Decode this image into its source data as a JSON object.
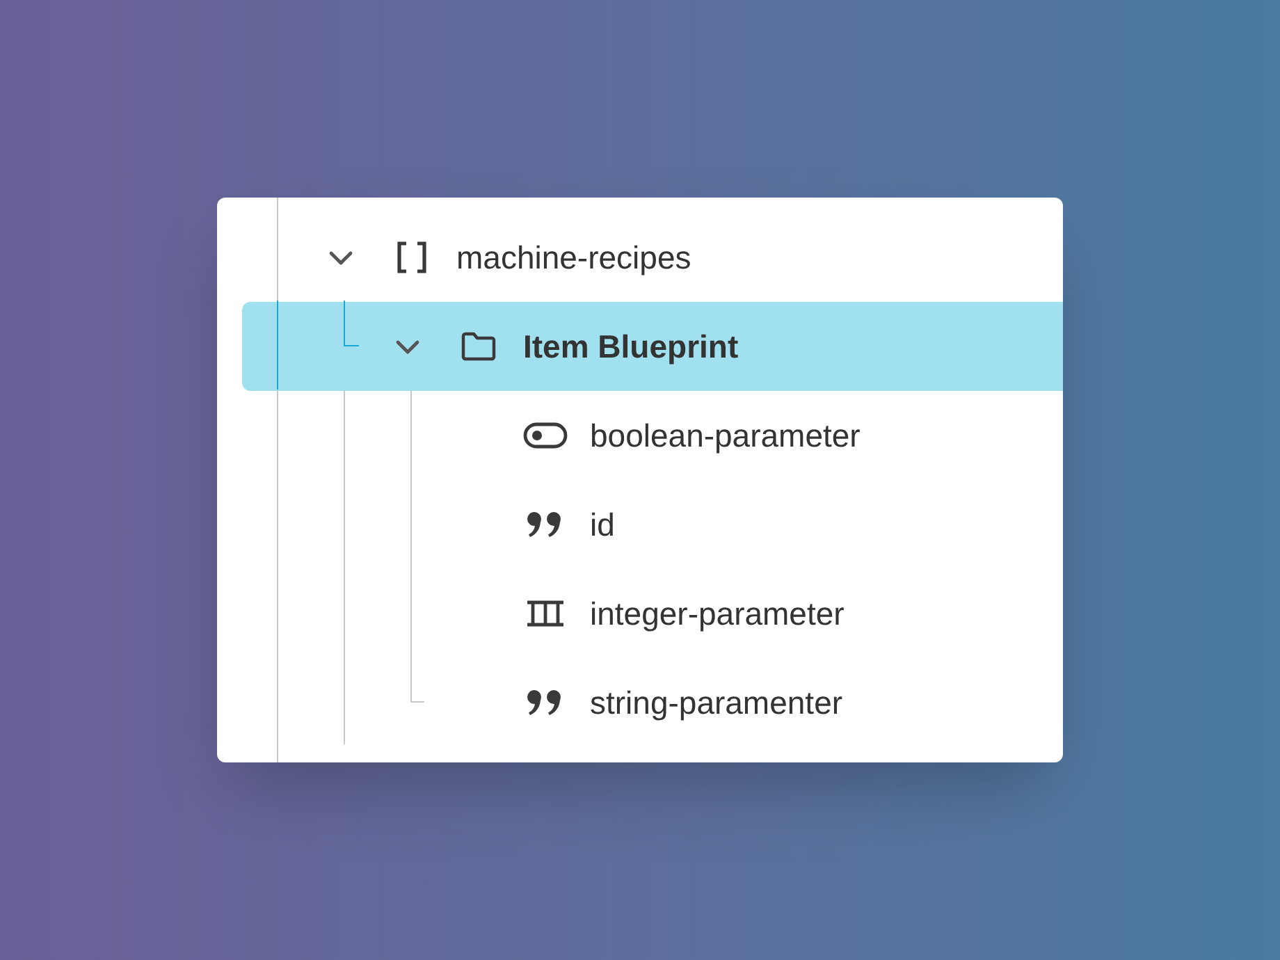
{
  "tree": [
    {
      "label": "machine-recipes",
      "kind": "array",
      "expanded": true,
      "selected": false,
      "children": [
        {
          "label": "Item Blueprint",
          "kind": "object",
          "expanded": true,
          "selected": true,
          "children": [
            {
              "label": "boolean-parameter",
              "kind": "boolean",
              "selected": false
            },
            {
              "label": "id",
              "kind": "string",
              "selected": false
            },
            {
              "label": "integer-parameter",
              "kind": "integer",
              "selected": false
            },
            {
              "label": "string-paramenter",
              "kind": "string",
              "selected": false
            }
          ]
        }
      ]
    }
  ]
}
